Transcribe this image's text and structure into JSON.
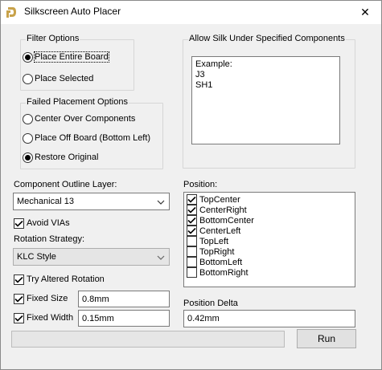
{
  "window": {
    "title": "Silkscreen Auto Placer",
    "close_glyph": "✕"
  },
  "filter_options": {
    "legend": "Filter Options",
    "items": [
      {
        "label": "Place Entire Board",
        "selected": true
      },
      {
        "label": "Place Selected",
        "selected": false
      }
    ]
  },
  "failed_placement": {
    "legend": "Failed Placement Options",
    "items": [
      {
        "label": "Center Over Components",
        "selected": false
      },
      {
        "label": "Place Off Board (Bottom Left)",
        "selected": false
      },
      {
        "label": "Restore Original",
        "selected": true
      }
    ]
  },
  "allow_silk": {
    "legend": "Allow Silk Under Specified Components",
    "lines": [
      "Example:",
      "J3",
      "SH1"
    ]
  },
  "outline_layer": {
    "label": "Component Outline Layer:",
    "value": "Mechanical 13"
  },
  "avoid_vias": {
    "label": "Avoid VIAs",
    "checked": true
  },
  "rotation_strategy": {
    "label": "Rotation Strategy:",
    "value": "KLC Style",
    "enabled": false
  },
  "try_altered_rotation": {
    "label": "Try Altered Rotation",
    "checked": true
  },
  "fixed_size": {
    "label": "Fixed Size",
    "checked": true,
    "value": "0.8mm"
  },
  "fixed_width": {
    "label": "Fixed Width",
    "checked": true,
    "value": "0.15mm"
  },
  "position": {
    "label": "Position:",
    "items": [
      {
        "label": "TopCenter",
        "checked": true
      },
      {
        "label": "CenterRight",
        "checked": true
      },
      {
        "label": "BottomCenter",
        "checked": true
      },
      {
        "label": "CenterLeft",
        "checked": true
      },
      {
        "label": "TopLeft",
        "checked": false
      },
      {
        "label": "TopRight",
        "checked": false
      },
      {
        "label": "BottomLeft",
        "checked": false
      },
      {
        "label": "BottomRight",
        "checked": false
      }
    ]
  },
  "position_delta": {
    "label": "Position Delta",
    "value": "0.42mm"
  },
  "progress": {
    "value": 0
  },
  "run_button": {
    "label": "Run"
  },
  "colors": {
    "window_bg": "#f0f0f0",
    "titlebar_bg": "#ffffff",
    "app_icon": "#c8a24a"
  }
}
